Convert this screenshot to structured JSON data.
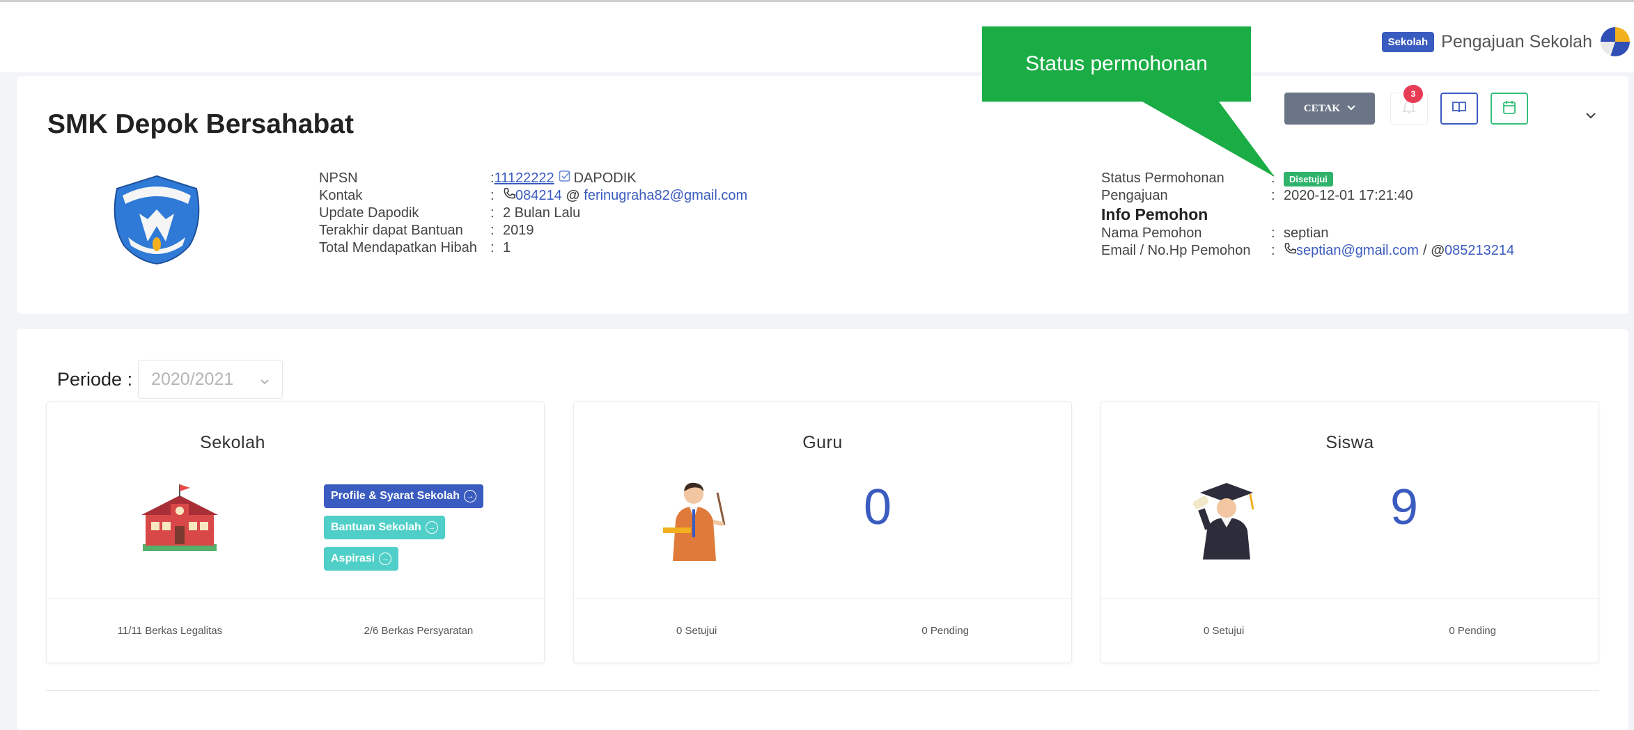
{
  "header": {
    "role_badge": "Sekolah",
    "user_name": "Pengajuan Sekolah"
  },
  "school": {
    "name": "SMK Depok Bersahabat",
    "actions": {
      "print_label": "CETAK",
      "notification_count": "3"
    },
    "info": {
      "npsn_label": "NPSN",
      "npsn_value": "11122222",
      "npsn_source": "DAPODIK",
      "contact_label": "Kontak",
      "contact_phone": "084214",
      "contact_email": "ferinugraha82@gmail.com",
      "update_label": "Update Dapodik",
      "update_value": "2 Bulan Lalu",
      "last_aid_label": "Terakhir dapat Bantuan",
      "last_aid_value": "2019",
      "total_grant_label": "Total Mendapatkan Hibah",
      "total_grant_value": "1"
    },
    "application": {
      "status_label": "Status Permohonan",
      "status_value": "Disetujui",
      "submitted_label": "Pengajuan",
      "submitted_value": "2020-12-01 17:21:40",
      "applicant_heading": "Info Pemohon",
      "applicant_name_label": "Nama Pemohon",
      "applicant_name_value": "septian",
      "applicant_contact_label": "Email / No.Hp Pemohon",
      "applicant_email": "septian@gmail.com",
      "applicant_phone": "085213214"
    }
  },
  "annotation": {
    "callout_text": "Status permohonan"
  },
  "periode": {
    "label": "Periode :",
    "value": "2020/2021"
  },
  "panels": {
    "sekolah": {
      "title": "Sekolah",
      "buttons": [
        "Profile & Syarat Sekolah",
        "Bantuan Sekolah",
        "Aspirasi"
      ],
      "footer_left": "11/11 Berkas Legalitas",
      "footer_right": "2/6 Berkas Persyaratan"
    },
    "guru": {
      "title": "Guru",
      "count": "0",
      "footer_left": "0 Setujui",
      "footer_right": "0 Pending"
    },
    "siswa": {
      "title": "Siswa",
      "count": "9",
      "footer_left": "0 Setujui",
      "footer_right": "0 Pending"
    }
  },
  "colors": {
    "primary": "#3a5bbf",
    "teal": "#4fcfc7",
    "success": "#2fb36b",
    "danger": "#e83b55",
    "callout": "#1aad45",
    "secondary": "#6b7587"
  }
}
